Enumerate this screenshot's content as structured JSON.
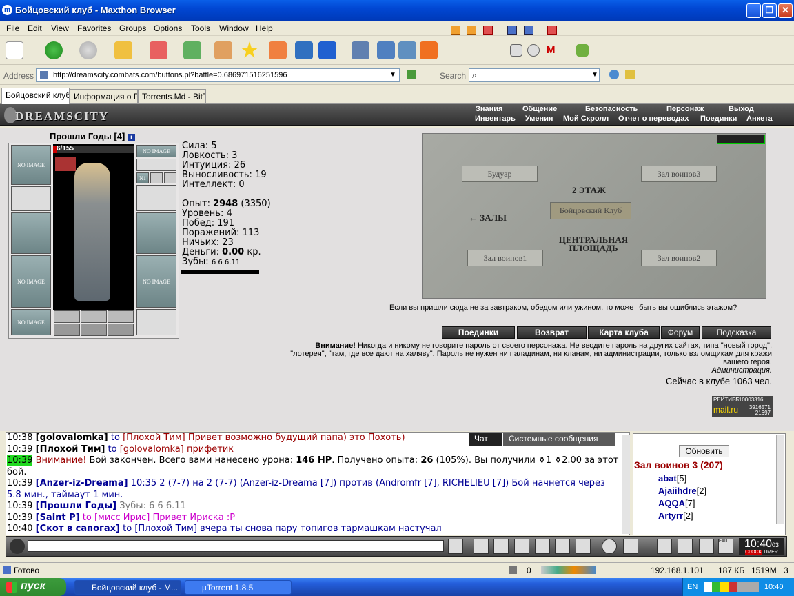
{
  "window": {
    "title": "Бойцовский клуб - Maxthon Browser"
  },
  "menu": [
    "File",
    "Edit",
    "View",
    "Favorites",
    "Groups",
    "Options",
    "Tools",
    "Window",
    "Help"
  ],
  "address": {
    "label": "Address",
    "url": "http://dreamscity.combats.com/buttons.pl?battle=0.686971516251596",
    "search_label": "Search"
  },
  "tabs": [
    "Бойцовский клуб",
    "Информация о Р...",
    "Torrents.Md - BitTor..."
  ],
  "game": {
    "logo": "DREAMSCITY",
    "nav_top": [
      "Знания",
      "Общение",
      "Безопасность",
      "Персонаж",
      "Выход"
    ],
    "nav_bottom": [
      "Инвентарь",
      "Умения",
      "Мой Скролл",
      "Отчет о переводах",
      "Поединки",
      "Анкета"
    ],
    "character": {
      "name": "Прошли Годы",
      "level": "[4]",
      "hp": "6/155",
      "hp_fraction": 0.04,
      "no_image": "NO IMAGE",
      "slot_n1": "N1"
    },
    "stats": {
      "strength": "Сила: 5",
      "agility": "Ловкость: 3",
      "intuition": "Интуиция: 26",
      "endurance": "Выносливость: 19",
      "intellect": "Интеллект: 0",
      "exp_label": "Опыт:",
      "exp_value": "2948",
      "exp_next": "(3350)",
      "level": "Уровень: 4",
      "wins": "Побед: 191",
      "losses": "Поражений: 113",
      "draws": "Ничьих: 23",
      "money_label": "Деньги:",
      "money_value": "0.00",
      "money_unit": "кр.",
      "teeth_label": "Зубы:",
      "teeth": "6 6 6.11"
    },
    "map": {
      "rooms": [
        "Будуар",
        "Зал воинов3",
        "2 ЭТАЖ",
        "Бойцовский Клуб",
        "← ЗАЛЫ",
        "ЦЕНТРАЛЬНАЯ ПЛОЩАДЬ",
        "Зал воинов1",
        "Зал воинов2"
      ],
      "tip": "Если вы пришли сюда не за завтраком, обедом или ужином, то может быть вы ошиблись этажом?"
    },
    "buttons": [
      "Поединки",
      "Возврат",
      "Карта клуба",
      "Форум",
      "Подсказка"
    ],
    "warning": {
      "bold": "Внимание!",
      "text": " Никогда и никому не говорите пароль от своего персонажа. Не вводите пароль на других сайтах, типа \"новый город\", \"лотерея\", \"там, где все дают на халяву\". Пароль не нужен ни паладинам, ни кланам, ни администрации, ",
      "link": "только взломщикам",
      "tail": " для кражи вашего героя.",
      "sign": "Администрация."
    },
    "online": "Сейчас в клубе 1063 чел.",
    "counter": {
      "brand": "mail.ru",
      "label": "РЕЙТИНГ",
      "line1": "3510003316",
      "line2": "3916571",
      "line3": "21697"
    }
  },
  "chat": {
    "tabs": [
      "Чат",
      "Системные сообщения"
    ],
    "lines": [
      {
        "time": "10:38",
        "nick": "golovalomka",
        "to": "to",
        "target": "[Плохой Тим]",
        "msg": " Привет возможно будущий папа) это Похоть)",
        "cls": "mr"
      },
      {
        "time": "10:39",
        "nick": "Плохой Тим",
        "to": "to",
        "target": "[golovalomka]",
        "msg": " прифетик",
        "cls": "mr"
      },
      {
        "time": "10:39",
        "sys": "Внимание!",
        "msg": " Бой закончен. Всего вами нанесено урона: ",
        "hp": "146 HP",
        "msg2": ". Получено опыта: ",
        "exp": "26",
        "msg3": " (105%). Вы получили ⚱1 ⚱2.00 за этот бой."
      },
      {
        "time": "10:39",
        "nick": "Anzer-iz-Dreama",
        "msg": " 10:35 2 (7-7) на 2 (7-7) (Anzer-iz-Dreama [7]) против (Andromfr [7], RICHELIEU [7]) Бой начнется через 5.8 мин., таймаут 1 мин.",
        "cls": "mb"
      },
      {
        "time": "10:39",
        "nick": "Прошли Годы",
        "msg": " Зубы: 6 6 6.11",
        "cls": "mgr"
      },
      {
        "time": "10:39",
        "nick": "Saint P",
        "to": "to",
        "target": "[мисс Ирис]",
        "msg": " Привет Ириска :P",
        "cls": "mg"
      },
      {
        "time": "10:40",
        "nick": "Скот в сапогах",
        "to": "to",
        "target": "[Плохой Тим]",
        "msg": " вчера ты снова пару топигов тармашкам настучал",
        "cls": "mb"
      }
    ]
  },
  "room": {
    "refresh": "Обновить",
    "title": "Зал воинов 3 (207)",
    "users": [
      {
        "name": "abat",
        "level": "[5]"
      },
      {
        "name": "Ajaiihdre",
        "level": "[2]"
      },
      {
        "name": "AQQA",
        "level": "[7]"
      },
      {
        "name": "Artyrr",
        "level": "[2]"
      }
    ]
  },
  "clock": {
    "time": "10:40",
    "sec": "03",
    "clock_label": "CLOCK",
    "timer_label": "TIMER",
    "exit": "EXIT"
  },
  "status": {
    "text": "Готово",
    "count": "0",
    "ip": "192.168.1.101",
    "kb": "187 КБ",
    "mem": "1519М",
    "num": "3"
  },
  "taskbar": {
    "start": "пуск",
    "tasks": [
      "Бойцовский клуб - M...",
      "µTorrent 1.8.5"
    ],
    "lang": "EN",
    "time": "10:40"
  }
}
